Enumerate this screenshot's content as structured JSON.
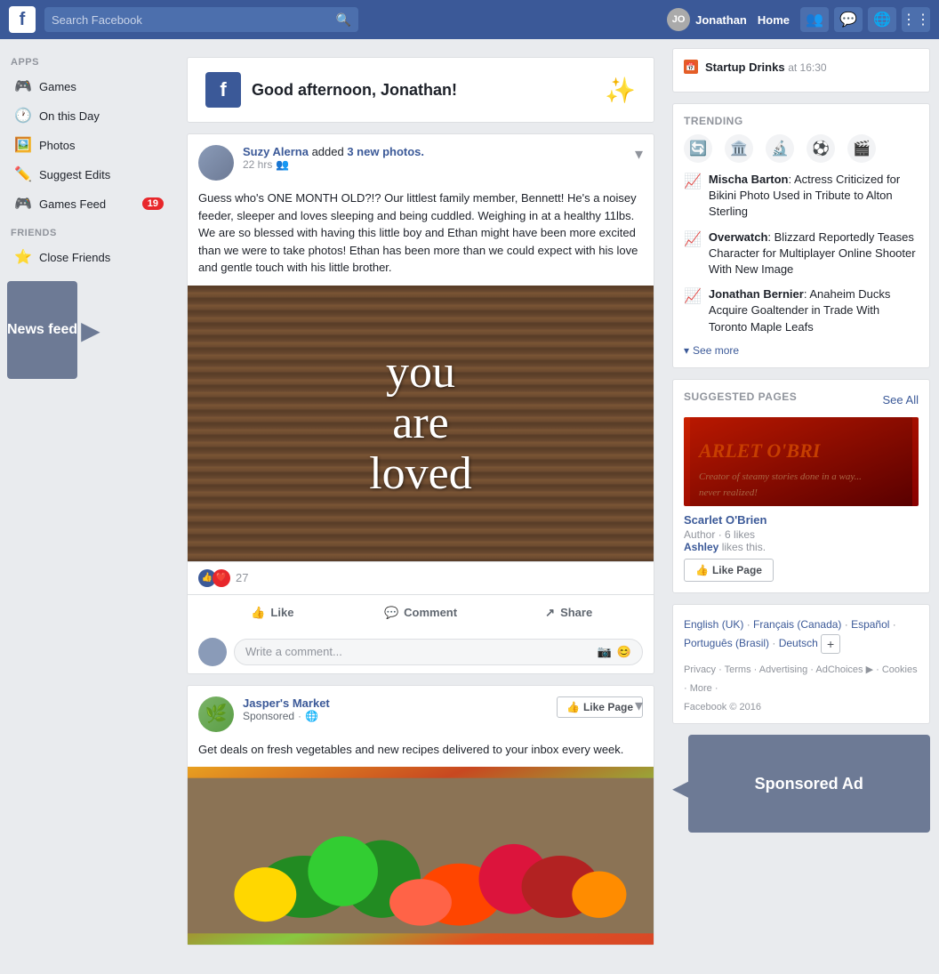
{
  "topnav": {
    "logo": "f",
    "search_placeholder": "Search Facebook",
    "user_name": "Jonathan",
    "home_label": "Home"
  },
  "sidebar_left": {
    "apps_label": "APPS",
    "friends_label": "FRIENDS",
    "items": [
      {
        "id": "games",
        "label": "Games",
        "icon": "🎮"
      },
      {
        "id": "on-this-day",
        "label": "On this Day",
        "icon": "🕐"
      },
      {
        "id": "photos",
        "label": "Photos",
        "icon": "🖼️"
      },
      {
        "id": "suggest-edits",
        "label": "Suggest Edits",
        "icon": "✏️"
      },
      {
        "id": "games-feed",
        "label": "Games Feed",
        "icon": "🎮",
        "badge": "19"
      }
    ],
    "friends_items": [
      {
        "id": "close-friends",
        "label": "Close Friends",
        "icon": "⭐"
      }
    ],
    "news_feed_label": "News feed"
  },
  "greeting": {
    "text": "Good afternoon, Jonathan!"
  },
  "post1": {
    "author": "Suzy Alerna",
    "action": "added",
    "link": "3 new photos.",
    "time": "22 hrs",
    "privacy": "friends",
    "content": "Guess who's ONE MONTH OLD?!? Our littlest family member, Bennett! He's a noisey feeder, sleeper and loves sleeping and being cuddled. Weighing in at a healthy 11lbs. We are so blessed with having this little boy and Ethan might have been more excited than we were to take photos! Ethan has been more than we could expect with his love and gentle touch with his little brother.",
    "image_text": "you\nare\nloved",
    "reactions": "27",
    "like_label": "Like",
    "comment_label": "Comment",
    "share_label": "Share",
    "comment_placeholder": "Write a comment..."
  },
  "post2": {
    "author": "Jasper's Market",
    "sponsored": "Sponsored",
    "privacy": "globe",
    "like_page_label": "Like Page",
    "content": "Get deals on fresh vegetables and new recipes delivered to your inbox every week."
  },
  "right_sidebar": {
    "event": {
      "title": "Startup Drinks",
      "time": "at 16:30"
    },
    "trending_label": "TRENDING",
    "trending_items": [
      {
        "name": "Mischa Barton",
        "text": ": Actress Criticized for Bikini Photo Used in Tribute to Alton Sterling"
      },
      {
        "name": "Overwatch",
        "text": ": Blizzard Reportedly Teases Character for Multiplayer Online Shooter With New Image"
      },
      {
        "name": "Jonathan Bernier",
        "text": ": Anaheim Ducks Acquire Goaltender in Trade With Toronto Maple Leafs"
      }
    ],
    "see_more": "See more",
    "suggested_pages_label": "SUGGESTED PAGES",
    "see_all": "See All",
    "suggested_page": {
      "name": "Scarlet O'Brien",
      "image_text": "ARLET O'BRI",
      "meta_label": "Author",
      "likes": "6 likes",
      "liker": "Ashley",
      "liker_text": "likes this.",
      "like_btn": "Like Page"
    },
    "language_row": "English (UK) · Français (Canada) · Español · Português (Brasil) · Deutsch",
    "language_links": [
      "English (UK)",
      "Français (Canada)",
      "Español",
      "Português (Brasil)",
      "Deutsch"
    ],
    "footer_links": [
      "Privacy",
      "Terms",
      "Advertising",
      "AdChoices",
      "Cookies",
      "More"
    ],
    "copyright": "Facebook © 2016",
    "sponsored_ad_label": "Sponsored Ad"
  }
}
